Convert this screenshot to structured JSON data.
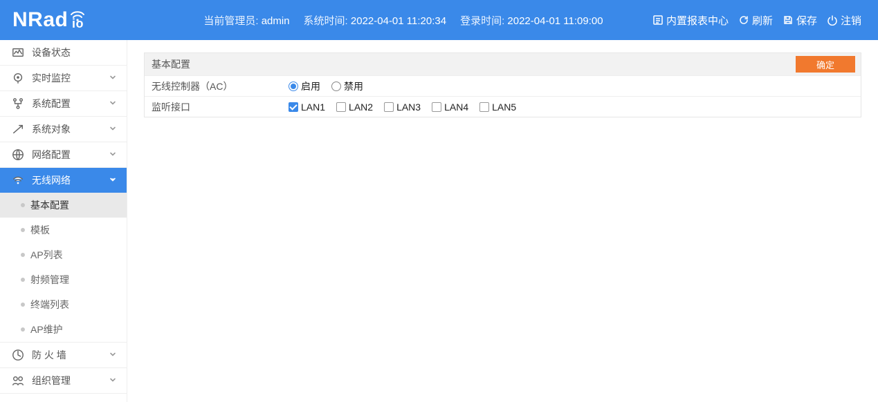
{
  "brand": "NRadio",
  "header": {
    "admin_label": "当前管理员:",
    "admin_value": "admin",
    "systime_label": "系统时间:",
    "systime_value": "2022-04-01 11:20:34",
    "logintime_label": "登录时间:",
    "logintime_value": "2022-04-01 11:09:00",
    "actions": {
      "report": "内置报表中心",
      "refresh": "刷新",
      "save": "保存",
      "logout": "注销"
    }
  },
  "sidebar": {
    "items": [
      {
        "label": "设备状态",
        "icon": "status",
        "expandable": false
      },
      {
        "label": "实时监控",
        "icon": "monitor",
        "expandable": true
      },
      {
        "label": "系统配置",
        "icon": "sysconf",
        "expandable": true
      },
      {
        "label": "系统对象",
        "icon": "sysobj",
        "expandable": true
      },
      {
        "label": "网络配置",
        "icon": "netconf",
        "expandable": true
      },
      {
        "label": "无线网络",
        "icon": "wifi",
        "expandable": true,
        "active": true,
        "subs": [
          {
            "label": "基本配置",
            "selected": true
          },
          {
            "label": "模板"
          },
          {
            "label": "AP列表"
          },
          {
            "label": "射频管理"
          },
          {
            "label": "终端列表"
          },
          {
            "label": "AP维护"
          }
        ]
      },
      {
        "label": "防 火 墙",
        "icon": "firewall",
        "expandable": true
      },
      {
        "label": "组织管理",
        "icon": "org",
        "expandable": true
      }
    ]
  },
  "panel": {
    "title": "基本配置",
    "confirm": "确定",
    "row_ac": {
      "label": "无线控制器（AC）",
      "options": [
        {
          "label": "启用",
          "value": "enable",
          "checked": true
        },
        {
          "label": "禁用",
          "value": "disable",
          "checked": false
        }
      ]
    },
    "row_listen": {
      "label": "监听接口",
      "options": [
        {
          "label": "LAN1",
          "checked": true
        },
        {
          "label": "LAN2",
          "checked": false
        },
        {
          "label": "LAN3",
          "checked": false
        },
        {
          "label": "LAN4",
          "checked": false
        },
        {
          "label": "LAN5",
          "checked": false
        }
      ]
    }
  }
}
